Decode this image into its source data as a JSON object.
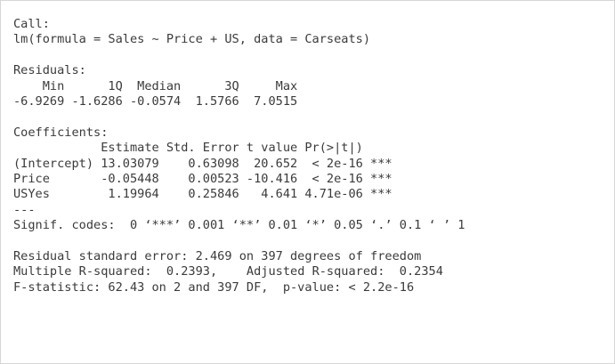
{
  "console": {
    "lines": [
      "Call:",
      "lm(formula = Sales ~ Price + US, data = Carseats)",
      "",
      "Residuals:",
      "    Min      1Q  Median      3Q     Max ",
      "-6.9269 -1.6286 -0.0574  1.5766  7.0515 ",
      "",
      "Coefficients:",
      "            Estimate Std. Error t value Pr(>|t|)    ",
      "(Intercept) 13.03079    0.63098  20.652  < 2e-16 ***",
      "Price       -0.05448    0.00523 -10.416  < 2e-16 ***",
      "USYes        1.19964    0.25846   4.641 4.71e-06 ***",
      "---",
      "Signif. codes:  0 ‘***’ 0.001 ‘**’ 0.01 ‘*’ 0.05 ‘.’ 0.1 ‘ ’ 1",
      "",
      "Residual standard error: 2.469 on 397 degrees of freedom",
      "Multiple R-squared:  0.2393,\tAdjusted R-squared:  0.2354 ",
      "F-statistic: 62.43 on 2 and 397 DF,  p-value: < 2.2e-16"
    ]
  }
}
